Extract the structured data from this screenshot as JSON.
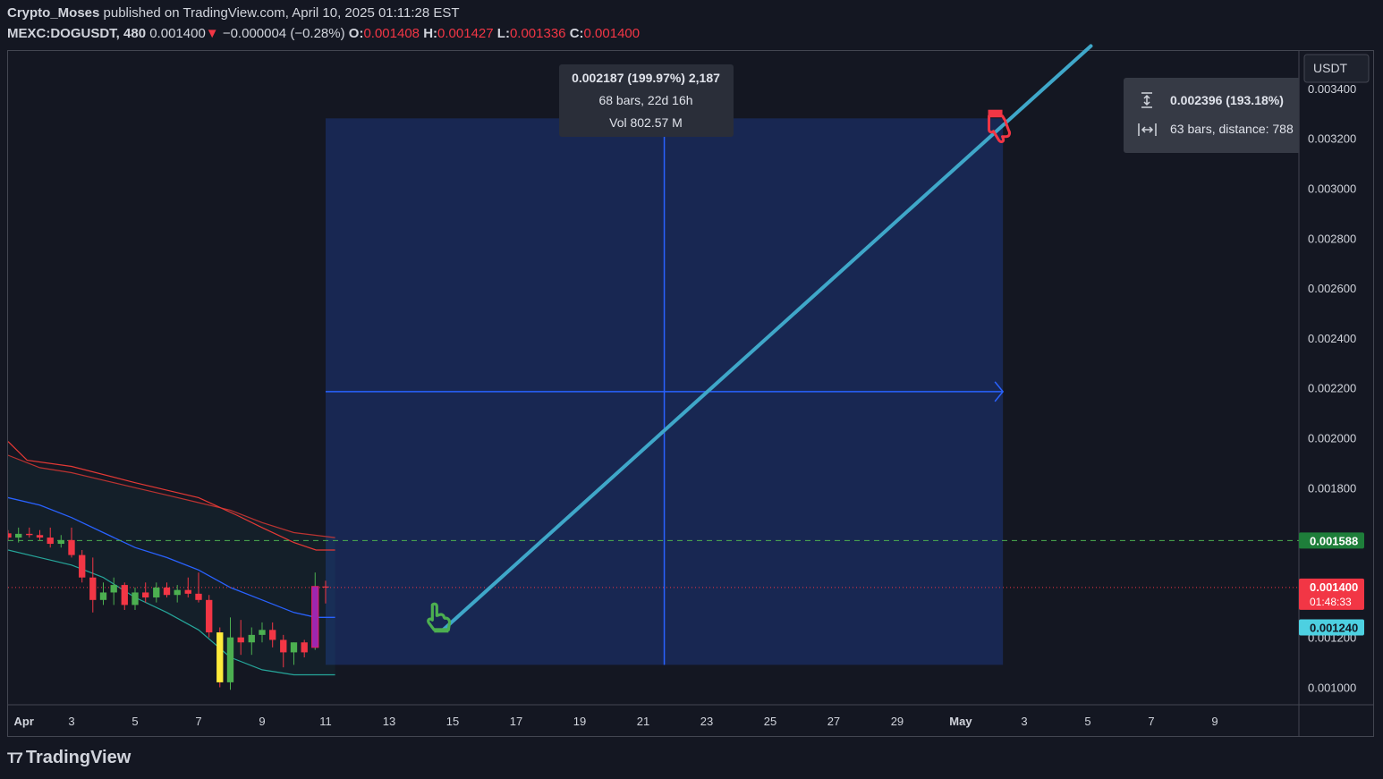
{
  "header": {
    "author": "Crypto_Moses",
    "published_text": "published on TradingView.com, April 10, 2025 01:11:28 EST",
    "symbol": "MEXC:DOGUSDT, 480",
    "last": "0.001400",
    "change_arrow": "▼",
    "change": "−0.000004 (−0.28%)",
    "o_label": "O:",
    "o_value": "0.001408",
    "h_label": "H:",
    "h_value": "0.001427",
    "l_label": "L:",
    "l_value": "0.001336",
    "c_label": "C:",
    "c_value": "0.001400"
  },
  "currency_button": "USDT",
  "brand": "TradingView",
  "colors": {
    "background": "#141722",
    "up": "#4caf50",
    "down": "#f23645",
    "trend_line": "#3fa7c9",
    "measure_blue": "#2962ff",
    "upper_band": "#e53935",
    "basis": "#2962ff",
    "lower_band": "#26a69a"
  },
  "chart_data": {
    "type": "candlestick",
    "symbol": "MEXC:DOGUSDT",
    "interval": "480",
    "y_axis": {
      "range": [
        0.00093,
        0.00355
      ],
      "ticks": [
        "0.001000",
        "0.001200",
        "0.001400",
        "0.001600",
        "0.001800",
        "0.002000",
        "0.002200",
        "0.002400",
        "0.002600",
        "0.002800",
        "0.003000",
        "0.003200",
        "0.003400"
      ]
    },
    "x_axis": {
      "labels": [
        {
          "t": 0.5,
          "label": "Apr"
        },
        {
          "t": 2,
          "label": "3"
        },
        {
          "t": 4,
          "label": "5"
        },
        {
          "t": 6,
          "label": "7"
        },
        {
          "t": 8,
          "label": "9"
        },
        {
          "t": 10,
          "label": "11"
        },
        {
          "t": 12,
          "label": "13"
        },
        {
          "t": 14,
          "label": "15"
        },
        {
          "t": 16,
          "label": "17"
        },
        {
          "t": 18,
          "label": "19"
        },
        {
          "t": 20,
          "label": "21"
        },
        {
          "t": 22,
          "label": "23"
        },
        {
          "t": 24,
          "label": "25"
        },
        {
          "t": 26,
          "label": "27"
        },
        {
          "t": 28,
          "label": "29"
        },
        {
          "t": 30,
          "label": "May"
        },
        {
          "t": 32,
          "label": "3"
        },
        {
          "t": 34,
          "label": "5"
        },
        {
          "t": 36,
          "label": "7"
        },
        {
          "t": 38,
          "label": "9"
        }
      ],
      "range_days": [
        0,
        40.65
      ]
    },
    "candles": [
      [
        0.0,
        0.001617,
        0.00163,
        0.00159,
        0.0016
      ],
      [
        0.33,
        0.0016,
        0.00164,
        0.00158,
        0.001615
      ],
      [
        0.67,
        0.001615,
        0.00164,
        0.0016,
        0.00161
      ],
      [
        1.0,
        0.00161,
        0.00163,
        0.00159,
        0.0016
      ],
      [
        1.33,
        0.0016,
        0.00164,
        0.00156,
        0.001575
      ],
      [
        1.67,
        0.001575,
        0.00161,
        0.00156,
        0.00159
      ],
      [
        2.0,
        0.00159,
        0.00164,
        0.00152,
        0.00153
      ],
      [
        2.33,
        0.00153,
        0.00155,
        0.00142,
        0.00144
      ],
      [
        2.67,
        0.00144,
        0.00152,
        0.0013,
        0.00135
      ],
      [
        3.0,
        0.00135,
        0.00142,
        0.00133,
        0.00138
      ],
      [
        3.33,
        0.00138,
        0.00144,
        0.00133,
        0.00141
      ],
      [
        3.67,
        0.00141,
        0.00142,
        0.00131,
        0.00133
      ],
      [
        4.0,
        0.00133,
        0.0014,
        0.00131,
        0.00138
      ],
      [
        4.33,
        0.00138,
        0.00142,
        0.00134,
        0.00136
      ],
      [
        4.67,
        0.00136,
        0.00142,
        0.00134,
        0.0014
      ],
      [
        5.0,
        0.0014,
        0.00142,
        0.00136,
        0.00137
      ],
      [
        5.33,
        0.00137,
        0.00141,
        0.00134,
        0.00139
      ],
      [
        5.67,
        0.00139,
        0.00144,
        0.00136,
        0.001375
      ],
      [
        6.0,
        0.001375,
        0.00146,
        0.00134,
        0.00135
      ],
      [
        6.33,
        0.00135,
        0.00137,
        0.0012,
        0.00122
      ],
      [
        6.67,
        0.00122,
        0.00124,
        0.001,
        0.00102
      ],
      [
        7.0,
        0.00102,
        0.00128,
        0.00099,
        0.0012
      ],
      [
        7.33,
        0.0012,
        0.00127,
        0.00113,
        0.00118
      ],
      [
        7.67,
        0.00118,
        0.00124,
        0.00113,
        0.00121
      ],
      [
        8.0,
        0.00121,
        0.00126,
        0.00118,
        0.00123
      ],
      [
        8.33,
        0.00123,
        0.00126,
        0.00116,
        0.00119
      ],
      [
        8.67,
        0.00119,
        0.00121,
        0.00108,
        0.00114
      ],
      [
        9.0,
        0.00114,
        0.00118,
        0.00109,
        0.00118
      ],
      [
        9.33,
        0.00118,
        0.00119,
        0.00112,
        0.00114
      ],
      [
        9.67,
        0.00116,
        0.00146,
        0.00115,
        0.001404
      ],
      [
        10.0,
        0.001404,
        0.001427,
        0.001336,
        0.0014
      ]
    ],
    "purple_candle_index": 29,
    "moving_average": [
      [
        0.0,
        0.00176
      ],
      [
        1.0,
        0.00173
      ],
      [
        2.0,
        0.00168
      ],
      [
        3.0,
        0.00162
      ],
      [
        4.0,
        0.00156
      ],
      [
        5.0,
        0.00152
      ],
      [
        6.0,
        0.00147
      ],
      [
        7.0,
        0.0014
      ],
      [
        8.0,
        0.00135
      ],
      [
        9.0,
        0.0013
      ],
      [
        9.7,
        0.00128
      ],
      [
        10.3,
        0.00128
      ]
    ],
    "upper_band": [
      [
        0.0,
        0.00193
      ],
      [
        1.0,
        0.00188
      ],
      [
        2.0,
        0.00186
      ],
      [
        3.0,
        0.00183
      ],
      [
        4.0,
        0.0018
      ],
      [
        5.0,
        0.00177
      ],
      [
        6.0,
        0.00174
      ],
      [
        7.0,
        0.00171
      ],
      [
        8.0,
        0.00166
      ],
      [
        9.0,
        0.00162
      ],
      [
        10.3,
        0.0016
      ]
    ],
    "upper_band_2": [
      [
        0.0,
        0.001985
      ],
      [
        0.6,
        0.00191
      ],
      [
        2.0,
        0.001885
      ],
      [
        4.0,
        0.00182
      ],
      [
        6.0,
        0.00176
      ],
      [
        7.2,
        0.00169
      ],
      [
        8.0,
        0.00164
      ],
      [
        9.0,
        0.00158
      ],
      [
        9.7,
        0.00155
      ],
      [
        10.3,
        0.00155
      ]
    ],
    "lower_band": [
      [
        0.0,
        0.00155
      ],
      [
        1.0,
        0.00152
      ],
      [
        2.0,
        0.00149
      ],
      [
        3.0,
        0.00144
      ],
      [
        4.0,
        0.00136
      ],
      [
        5.0,
        0.0013
      ],
      [
        6.0,
        0.00123
      ],
      [
        7.0,
        0.00112
      ],
      [
        8.0,
        0.00107
      ],
      [
        9.0,
        0.00105
      ],
      [
        10.3,
        0.00105
      ]
    ],
    "horizontal_lines": [
      {
        "price": 0.001588,
        "style": "dashed",
        "color": "#4caf50"
      },
      {
        "price": 0.0014,
        "style": "dotted",
        "color": "#f23645"
      }
    ],
    "price_labels": [
      {
        "price": 0.001588,
        "text": "0.001588",
        "bg": "#1e7e3a",
        "fg": "#ffffff"
      },
      {
        "price": 0.0014,
        "text": "0.001400",
        "sub": "01:48:33",
        "bg": "#f23645",
        "fg": "#ffffff"
      },
      {
        "price": 0.00124,
        "text": "0.001240",
        "bg": "#4dd0e1",
        "fg": "#131722"
      }
    ],
    "date_price_range": {
      "t_start": 10.0,
      "t_end": 31.33,
      "p_low": 0.00109,
      "p_high": 0.00328,
      "stats": [
        "0.002187 (199.97%) 2,187",
        "68 bars, 22d 16h",
        "Vol 802.57 M"
      ]
    },
    "trend_line": {
      "start": [
        13.7,
        0.00123
      ],
      "end": [
        34.1,
        0.00357
      ]
    },
    "trend_stats": [
      "0.002396 (193.18%)",
      "63 bars, distance: 788"
    ]
  }
}
